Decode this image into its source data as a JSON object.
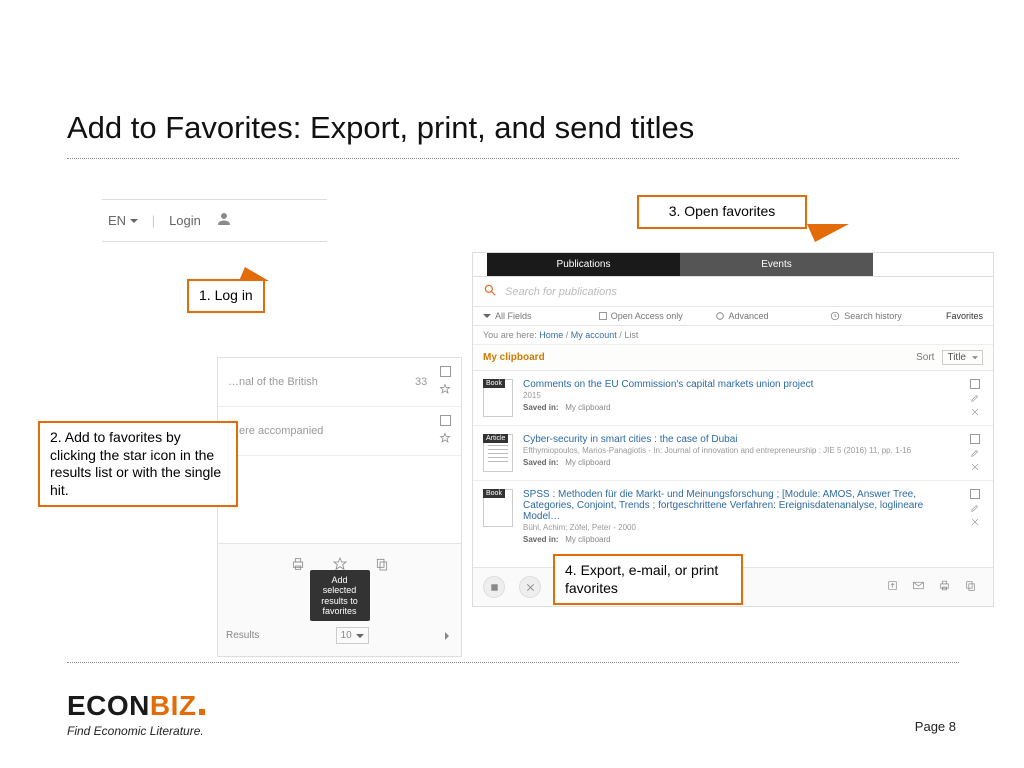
{
  "title": "Add to Favorites: Export, print, and send titles",
  "callouts": {
    "c1": "1. Log in",
    "c2": "2. Add to favorites by clicking the star icon in the results list or with the single hit.",
    "c3": "3. Open favorites",
    "c4": "4. Export, e-mail, or print favorites"
  },
  "login": {
    "lang": "EN",
    "login": "Login"
  },
  "left_results": {
    "rows": [
      {
        "text": "…nal of the British",
        "count": "33"
      },
      {
        "text": "…ere accompanied",
        "count": ""
      }
    ],
    "tooltip": "Add selected results to favorites",
    "footer_label": "Results",
    "per_page": "10"
  },
  "app": {
    "tabs": {
      "pub": "Publications",
      "evt": "Events"
    },
    "search_placeholder": "Search for publications",
    "filter": {
      "allfields": "All Fields",
      "oa": "Open Access only",
      "adv": "Advanced",
      "hist": "Search history",
      "fav": "Favorites"
    },
    "breadcrumb": {
      "here": "You are here:",
      "home": "Home",
      "acct": "My account",
      "list": "List"
    },
    "clipboard": "My clipboard",
    "sort_label": "Sort",
    "sort_value": "Title",
    "records": [
      {
        "badge": "Book",
        "title": "Comments on the EU Commission's capital markets union project",
        "sub": "2015",
        "saved_label": "Saved in:",
        "saved_val": "My clipboard"
      },
      {
        "badge": "Article",
        "title": "Cyber-security in smart cities : the case of Dubai",
        "sub": "Efthymiopoulos, Marios-Panagiotis - In: Journal of innovation and entrepreneurship : JIE 5 (2016) 11, pp. 1-16",
        "saved_label": "Saved in:",
        "saved_val": "My clipboard"
      },
      {
        "badge": "Book",
        "title": "SPSS : Methoden für die Markt- und Meinungsforschung ; [Module: AMOS, Answer Tree, Categories, Conjoint, Trends ; fortgeschrittene Verfahren: Ereignisdatenanalyse, loglineare Model…",
        "sub": "Bühl, Achim; Zöfel, Peter - 2000",
        "saved_label": "Saved in:",
        "saved_val": "My clipboard"
      }
    ]
  },
  "footer": {
    "logo_a": "ECON",
    "logo_b": "BIZ",
    "tagline": "Find Economic Literature.",
    "page": "Page 8"
  }
}
